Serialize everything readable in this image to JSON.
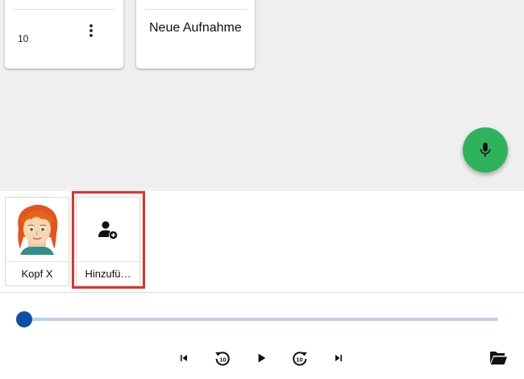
{
  "recordings": {
    "cards": [
      {
        "number": "10",
        "menu_icon": "more-vert-icon"
      },
      {
        "title": "Neue Aufnahme"
      }
    ]
  },
  "fab": {
    "icon": "microphone-icon",
    "color": "#2eb35c"
  },
  "speakers": {
    "items": [
      {
        "label": "Kopf X",
        "image": "avatar-red-hair"
      },
      {
        "label": "Hinzufü…",
        "icon": "add-person-icon",
        "highlighted": true
      }
    ],
    "highlight_color": "#e5302a"
  },
  "player": {
    "progress": 0,
    "track_color": "#bfd0ea",
    "thumb_color": "#0d4ea6",
    "controls": [
      "skip-previous-icon",
      "replay-10-icon",
      "play-icon",
      "forward-10-icon",
      "skip-next-icon"
    ],
    "folder_icon": "folder-open-icon"
  }
}
